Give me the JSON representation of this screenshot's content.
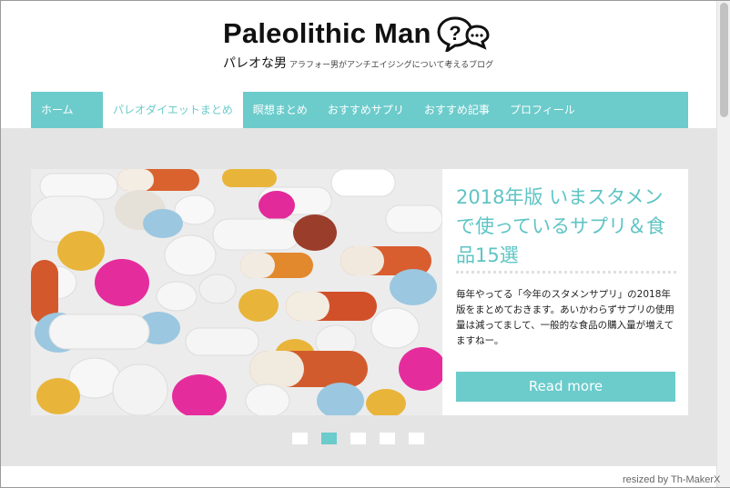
{
  "site": {
    "title": "Paleolithic Man",
    "tagline_main": "パレオな男",
    "tagline_sub": "アラフォー男がアンチエイジングについて考えるブログ",
    "logo_icon": "speech-bubbles-question-icon"
  },
  "nav": {
    "items": [
      {
        "label": "ホーム"
      },
      {
        "label": "パレオダイエットまとめ",
        "active": true
      },
      {
        "label": "瞑想まとめ"
      },
      {
        "label": "おすすめサプリ"
      },
      {
        "label": "おすすめ記事"
      },
      {
        "label": "プロフィール"
      }
    ]
  },
  "slider": {
    "title": "2018年版 いまスタメンで使っているサプリ＆食品15選",
    "excerpt": "毎年やってる「今年のスタメンサプリ」の2018年版をまとめておきます。あいかわらずサプリの使用量は減ってまして、一般的な食品の購入量が増えてますねー。",
    "read_more": "Read more",
    "active_dot": 2,
    "dot_count": 5,
    "image": "pills-and-capsules-photo"
  },
  "watermark": "resized by Th-MakerX",
  "colors": {
    "accent": "#6ccbcb",
    "band": "#e4e4e4",
    "title_teal": "#5fc4c4"
  }
}
